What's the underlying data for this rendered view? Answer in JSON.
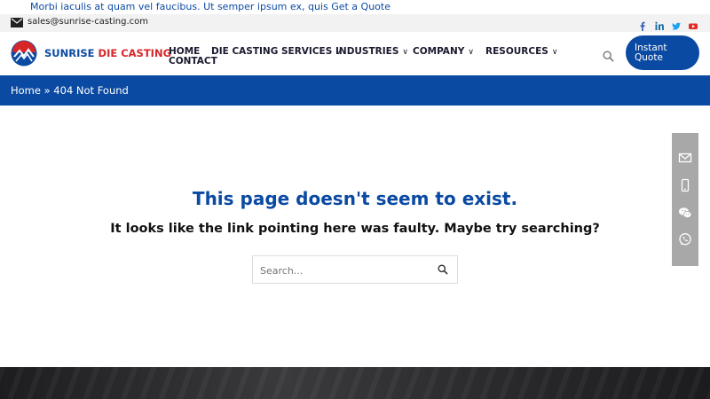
{
  "topbar": {
    "ticker_text": "Morbi iaculis at quam vel faucibus. Ut semper ipsum ex, quis ",
    "quote_link": "Get a Quote"
  },
  "contactbar": {
    "email": "sales@sunrise-casting.com",
    "social_icons": [
      "facebook-icon",
      "linkedin-icon",
      "twitter-icon",
      "youtube-icon"
    ]
  },
  "logo": {
    "part1": "SUNRISE ",
    "part2": "DIE CASTING"
  },
  "nav": {
    "home": "HOME",
    "services": "DIE CASTING SERVICES",
    "industries": "INDUSTRIES",
    "company": "COMPANY",
    "resources": "RESOURCES",
    "contact": "CONTACT",
    "chevron": "∨"
  },
  "quote_button": {
    "line1": "Instant",
    "line2": "Quote"
  },
  "breadcrumb": {
    "text": "Home » 404 Not Found"
  },
  "notfound": {
    "title": "This page doesn't seem to exist.",
    "message": "It looks like the link pointing here was faulty. Maybe try searching?"
  },
  "search": {
    "placeholder": "Search..."
  },
  "sidebar_icons": [
    "email-icon",
    "phone-icon",
    "wechat-icon",
    "whatsapp-icon"
  ],
  "colors": {
    "brand_blue": "#0b4aa2",
    "brand_red": "#d6262a",
    "sidebar_gray": "#a8a8a8"
  }
}
